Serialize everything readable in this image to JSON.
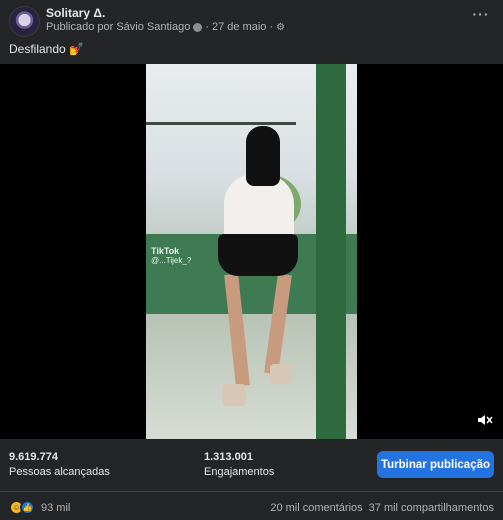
{
  "header": {
    "page_name": "Solitary Δ.",
    "published_by": "Publicado por Sávio Santiago",
    "separator": "·",
    "date": "27 de maio",
    "separator2": "·"
  },
  "post": {
    "caption_text": "Desfilando",
    "caption_emoji": "💅"
  },
  "video": {
    "watermark_brand": "TikTok",
    "watermark_user": "@...Tijek_?"
  },
  "insights": {
    "reach_value": "9.619.774",
    "reach_label": "Pessoas alcançadas",
    "engagement_value": "1.313.001",
    "engagement_label": "Engajamentos",
    "boost_label": "Turbinar publicação"
  },
  "footer": {
    "reaction_count": "93 mil",
    "comments": "20 mil comentários",
    "shares": "37 mil compartilhamentos"
  },
  "icons": {
    "more": "more-options-icon",
    "gear": "settings-icon",
    "volume": "volume-muted-icon",
    "haha": "haha-reaction-icon",
    "like": "like-reaction-icon"
  },
  "colors": {
    "background": "#242526",
    "video_background": "#000000",
    "accent": "#2374e1",
    "text_primary": "#e4e6eb",
    "text_secondary": "#b0b3b8"
  }
}
